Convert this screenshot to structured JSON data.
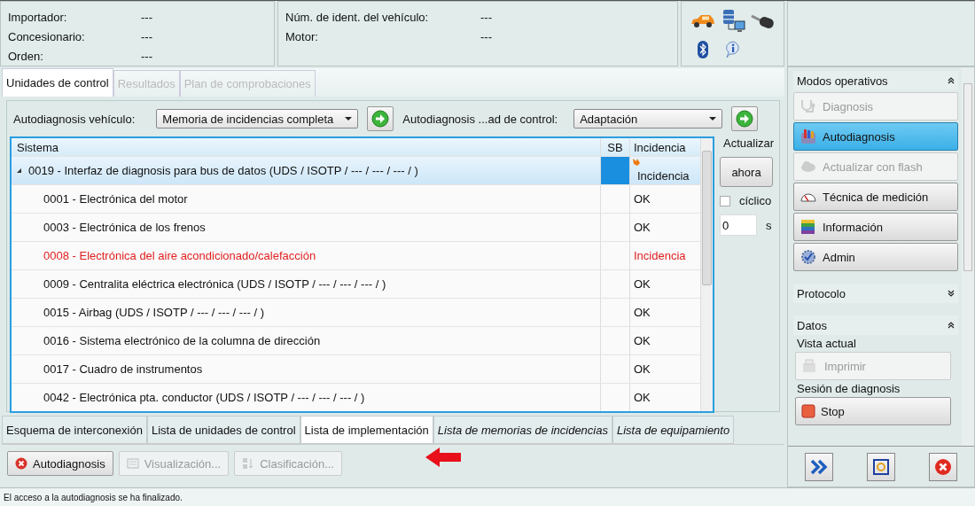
{
  "header": {
    "fields_left": [
      {
        "label": "Importador:",
        "value": "---"
      },
      {
        "label": "Concesionario:",
        "value": "---"
      },
      {
        "label": "Orden:",
        "value": "---"
      }
    ],
    "fields_right": [
      {
        "label": "Núm. de ident. del vehículo:",
        "value": "---"
      },
      {
        "label": "Motor:",
        "value": "---"
      }
    ]
  },
  "tabs": [
    {
      "label": "Unidades de control",
      "selected": true,
      "disabled": false
    },
    {
      "label": "Resultados",
      "selected": false,
      "disabled": true
    },
    {
      "label": "Plan de comprobaciones",
      "selected": false,
      "disabled": true
    }
  ],
  "toolbar": {
    "vehicle_label": "Autodiagnosis vehículo:",
    "vehicle_select": "Memoria de incidencias completa",
    "control_label": "Autodiagnosis ...ad de control:",
    "control_select": "Adaptación"
  },
  "table": {
    "columns": [
      "Sistema",
      "SB",
      "Incidencia"
    ],
    "rows": [
      {
        "system": "0019 - Interfaz de diagnosis para bus de datos  (UDS / ISOTP / --- / --- / --- /  )",
        "result": "Incidencia",
        "fault": false,
        "selected": true,
        "expanded": true,
        "children": [
          {
            "system": "0001 - Electrónica del motor",
            "result": "OK",
            "fault": false,
            "selected": false
          },
          {
            "system": "0003 - Electrónica de los frenos",
            "result": "OK",
            "fault": false,
            "selected": false
          },
          {
            "system": "0008 - Electrónica del aire acondicionado/calefacción",
            "result": "Incidencia",
            "fault": true,
            "selected": false
          },
          {
            "system": "0009 - Centralita eléctrica electrónica  (UDS / ISOTP / --- / --- / --- /  )",
            "result": "OK",
            "fault": false,
            "selected": false
          },
          {
            "system": "0015 - Airbag  (UDS / ISOTP / --- / --- / --- /  )",
            "result": "OK",
            "fault": false,
            "selected": false
          },
          {
            "system": "0016 - Sistema electrónico de la columna de dirección",
            "result": "OK",
            "fault": false,
            "selected": false
          },
          {
            "system": "0017 - Cuadro de instrumentos",
            "result": "OK",
            "fault": false,
            "selected": false
          },
          {
            "system": "0042 - Electrónica pta. conductor  (UDS / ISOTP / --- / --- / --- /  )",
            "result": "OK",
            "fault": false,
            "selected": false
          }
        ]
      }
    ]
  },
  "refresh": {
    "label": "Actualizar",
    "button": "ahora",
    "cyclic": {
      "label": "cíclico",
      "checked": false
    },
    "interval": {
      "value": "0",
      "unit": "s"
    }
  },
  "bottom_tabs": [
    {
      "label": "Esquema de interconexión",
      "selected": false,
      "disabled": false
    },
    {
      "label": "Lista de unidades de control",
      "selected": false,
      "disabled": false
    },
    {
      "label": "Lista de implementación",
      "selected": true,
      "disabled": false
    },
    {
      "label": "Lista de memorias de incidencias",
      "selected": false,
      "disabled": true
    },
    {
      "label": "Lista de equipamiento",
      "selected": false,
      "disabled": true
    }
  ],
  "actions": [
    {
      "label": "Autodiagnosis",
      "kind": "cancel",
      "disabled": false
    },
    {
      "label": "Visualización...",
      "kind": "view",
      "disabled": true
    },
    {
      "label": "Clasificación...",
      "kind": "sort",
      "disabled": true
    }
  ],
  "sidebar": {
    "sections": [
      {
        "title": "Modos operativos",
        "expanded": true,
        "groups": [
          {
            "items": [
              {
                "label": "Diagnosis",
                "kind": "stethoscope",
                "disabled": true,
                "selected": false
              },
              {
                "label": "Autodiagnosis",
                "kind": "tools",
                "disabled": false,
                "selected": true
              },
              {
                "label": "Actualizar con flash",
                "kind": "cloud",
                "disabled": true,
                "selected": false
              },
              {
                "label": "Técnica de medición",
                "kind": "gauge",
                "disabled": false,
                "selected": false
              },
              {
                "label": "Información",
                "kind": "books",
                "disabled": false,
                "selected": false
              },
              {
                "label": "Admin",
                "kind": "gear",
                "disabled": false,
                "selected": false
              }
            ]
          }
        ]
      },
      {
        "title": "Protocolo",
        "expanded": false
      },
      {
        "title": "Datos",
        "expanded": true,
        "groups": [
          {
            "title": "Vista actual",
            "items": [
              {
                "label": "Imprimir",
                "kind": "printer",
                "disabled": true,
                "selected": false
              }
            ]
          },
          {
            "title": "Sesión de diagnosis",
            "items": [
              {
                "label": "Stop",
                "kind": "stop",
                "disabled": false,
                "selected": false
              }
            ]
          }
        ]
      }
    ]
  },
  "sidebar_buttons": [
    {
      "kind": "forward"
    },
    {
      "kind": "frame"
    },
    {
      "kind": "close"
    }
  ],
  "status": "El acceso a la autodiagnosis se ha finalizado."
}
